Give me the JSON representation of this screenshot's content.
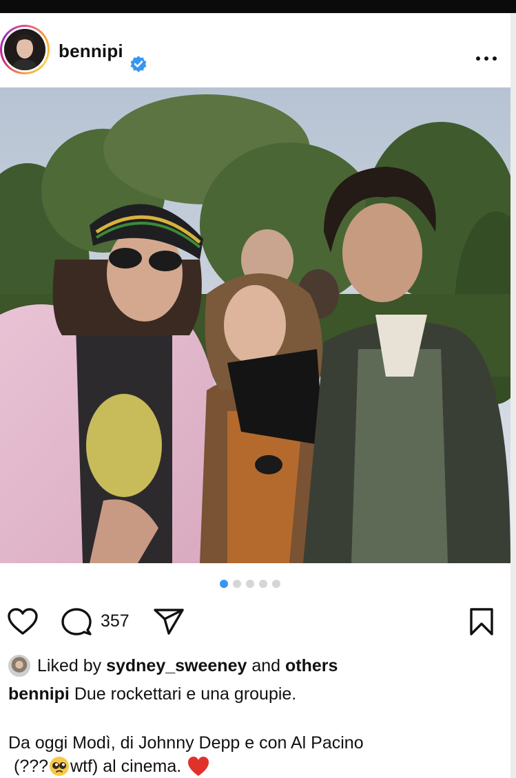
{
  "post": {
    "username": "bennipi",
    "verified": true,
    "comment_count": "357",
    "carousel": {
      "total": 5,
      "active_index": 0
    },
    "liked_by": {
      "prefix": "Liked by",
      "user": "sydney_sweeney",
      "middle": "and",
      "others": "others"
    },
    "caption": {
      "username": "bennipi",
      "line1": "Due rockettari e una groupie.",
      "line2": "Da oggi Modì, di Johnny Depp e con Al Pacino",
      "line3_a": "(???",
      "line3_b": "wtf) al cinema."
    }
  },
  "icons": {
    "verified": "verified-badge-icon",
    "more": "more-options-icon",
    "like": "heart-icon",
    "comment": "comment-bubble-icon",
    "share": "paper-plane-icon",
    "save": "bookmark-icon",
    "emoji1": "pleading-face-emoji",
    "emoji2": "red-heart-emoji"
  },
  "colors": {
    "verified_blue": "#3797f0",
    "active_dot": "#3797f0",
    "heart_red": "#e0312b"
  }
}
